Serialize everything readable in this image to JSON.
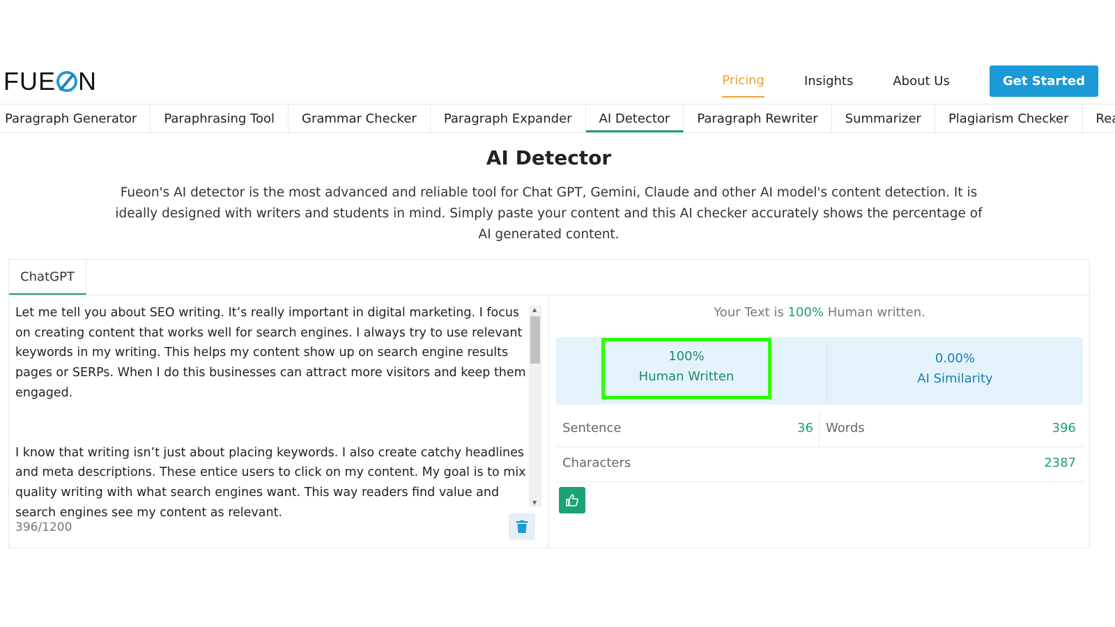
{
  "brand": {
    "logo_text": "FUEON",
    "logo_left": "FUE",
    "logo_right": "N"
  },
  "nav": {
    "items": [
      "Pricing",
      "Insights",
      "About Us"
    ],
    "active": "Pricing",
    "cta": "Get Started",
    "accent": "#f0a030",
    "cta_color": "#1a9ad6"
  },
  "tool_tabs": {
    "items": [
      "Paragraph Generator",
      "Paraphrasing Tool",
      "Grammar Checker",
      "Paragraph Expander",
      "AI Detector",
      "Paragraph Rewriter",
      "Summarizer",
      "Plagiarism Checker",
      "Readability Checker"
    ],
    "active": "AI Detector"
  },
  "page": {
    "title": "AI Detector",
    "description": "Fueon's AI detector is the most advanced and reliable tool for Chat GPT, Gemini, Claude and other AI model's content detection. It is ideally designed with writers and students in mind. Simply paste your content and this AI checker accurately shows the percentage of AI generated content."
  },
  "editor": {
    "tab": "ChatGPT",
    "paragraphs": [
      "Let me tell you about SEO writing. It’s really important in digital marketing. I focus on creating content that works well for search engines. I always try to use relevant keywords in my writing. This helps my content show up on search engine results pages or SERPs. When I do this  businesses can attract more visitors and keep them engaged.",
      "I know that writing isn’t just about placing keywords. I also create catchy headlines and meta descriptions. These entice users to click on my content. My goal is to mix quality writing with what search engines want. This way  readers find value  and search engines see my content as relevant."
    ],
    "word_count": "396/1200"
  },
  "result": {
    "verdict_prefix": "Your Text is ",
    "verdict_value": "100%",
    "verdict_suffix": " Human written.",
    "human_pct": "100%",
    "human_label": "Human Written",
    "ai_pct": "0.00%",
    "ai_label": "AI Similarity",
    "sentence_label": "Sentence",
    "sentence": "36",
    "words_label": "Words",
    "words": "396",
    "characters_label": "Characters",
    "characters": "2387"
  },
  "icons": {
    "delete": "trash-icon",
    "feedback": "thumbs-up-icon"
  }
}
